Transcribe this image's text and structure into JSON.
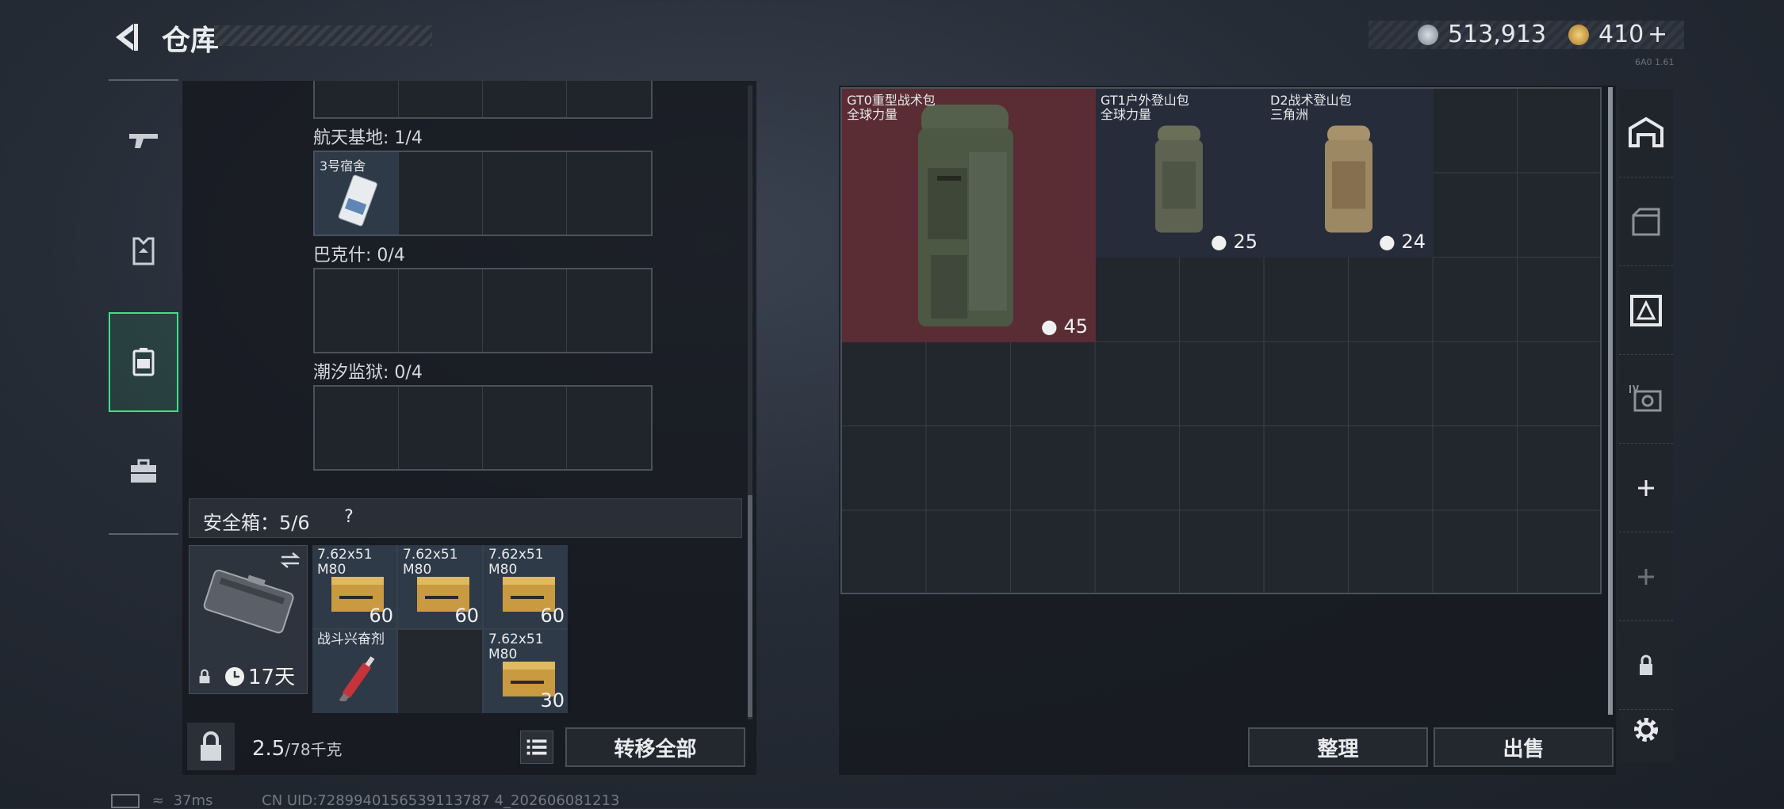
{
  "header": {
    "title": "仓库",
    "currency1": "513,913",
    "currency2": "410",
    "currency2_plus": "+",
    "version": "6A0 1.61"
  },
  "left_nav": {
    "items": [
      "weapon",
      "armor",
      "backpack",
      "case"
    ],
    "active": "backpack"
  },
  "sections": [
    {
      "label": "航天基地: 1/4",
      "items": [
        {
          "name": "3号宿舍"
        }
      ]
    },
    {
      "label": "巴克什: 0/4",
      "items": []
    },
    {
      "label": "潮汐监狱: 0/4",
      "items": []
    }
  ],
  "safe_box": {
    "label": "安全箱：5/6",
    "help": "?",
    "expires": "17天",
    "items": [
      {
        "name": "7.62x51\nM80",
        "count": "60",
        "kind": "ammo"
      },
      {
        "name": "7.62x51\nM80",
        "count": "60",
        "kind": "ammo"
      },
      {
        "name": "7.62x51\nM80",
        "count": "60",
        "kind": "ammo"
      },
      {
        "name": "战斗兴奋剂",
        "count": "",
        "kind": "stim"
      },
      {
        "name": "",
        "count": "",
        "kind": "empty"
      },
      {
        "name": "7.62x51\nM80",
        "count": "30",
        "kind": "ammo"
      }
    ]
  },
  "bottom_bar": {
    "weight_value": "2.5",
    "weight_unit": "/78千克",
    "transfer_all": "转移全部"
  },
  "stash": {
    "items": [
      {
        "name": "GT0重型战术包",
        "sub": "全球力量",
        "capacity": "45"
      },
      {
        "name": "GT1户外登山包",
        "sub": "全球力量",
        "capacity": "25"
      },
      {
        "name": "D2战术登山包",
        "sub": "三角洲",
        "capacity": "24"
      }
    ],
    "sort_button": "整理",
    "sell_button": "出售"
  },
  "right_nav": {
    "items": [
      "stash-tab-1",
      "stash-tab-2",
      "stash-tab-3",
      "stash-tab-4",
      "add",
      "add",
      "lock",
      "settings"
    ]
  },
  "footer": {
    "ping": "37ms",
    "uid": "CN UID:7289940156539113787 4_202606081213"
  },
  "colors": {
    "accent": "#3ee08a",
    "bag_highlight": "#5a2c33"
  }
}
